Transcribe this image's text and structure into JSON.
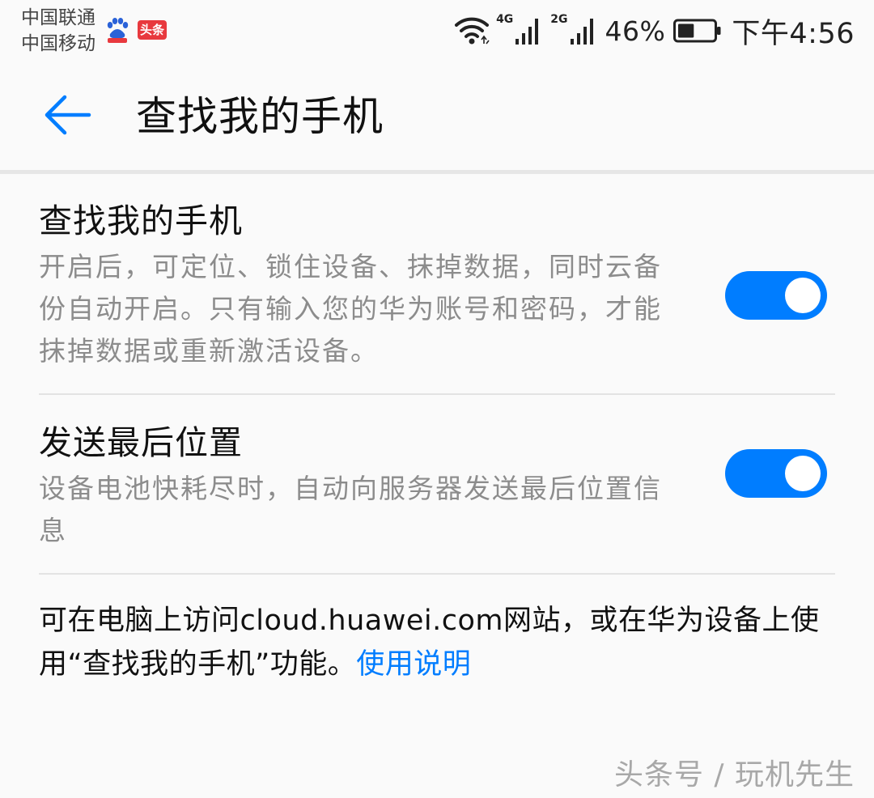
{
  "status_bar": {
    "carrier_1": "中国联通",
    "carrier_2": "中国移动",
    "toutiao_badge": "头条",
    "net_1": "4G",
    "net_2": "2G",
    "battery_percent": "46%",
    "battery_level": 0.46,
    "time": "下午4:56"
  },
  "app_bar": {
    "title": "查找我的手机"
  },
  "settings": [
    {
      "title": "查找我的手机",
      "description": "开启后，可定位、锁住设备、抹掉数据，同时云备份自动开启。只有输入您的华为账号和密码，才能抹掉数据或重新激活设备。",
      "enabled": true
    },
    {
      "title": "发送最后位置",
      "description": "设备电池快耗尽时，自动向服务器发送最后位置信息",
      "enabled": true
    }
  ],
  "footer": {
    "note": "可在电脑上访问cloud.huawei.com网站，或在华为设备上使用“查找我的手机”功能。",
    "help_link": "使用说明"
  },
  "watermark": "头条号 / 玩机先生",
  "colors": {
    "accent": "#007dff",
    "background": "#fafafa",
    "secondary_text": "#8c8c8c"
  }
}
